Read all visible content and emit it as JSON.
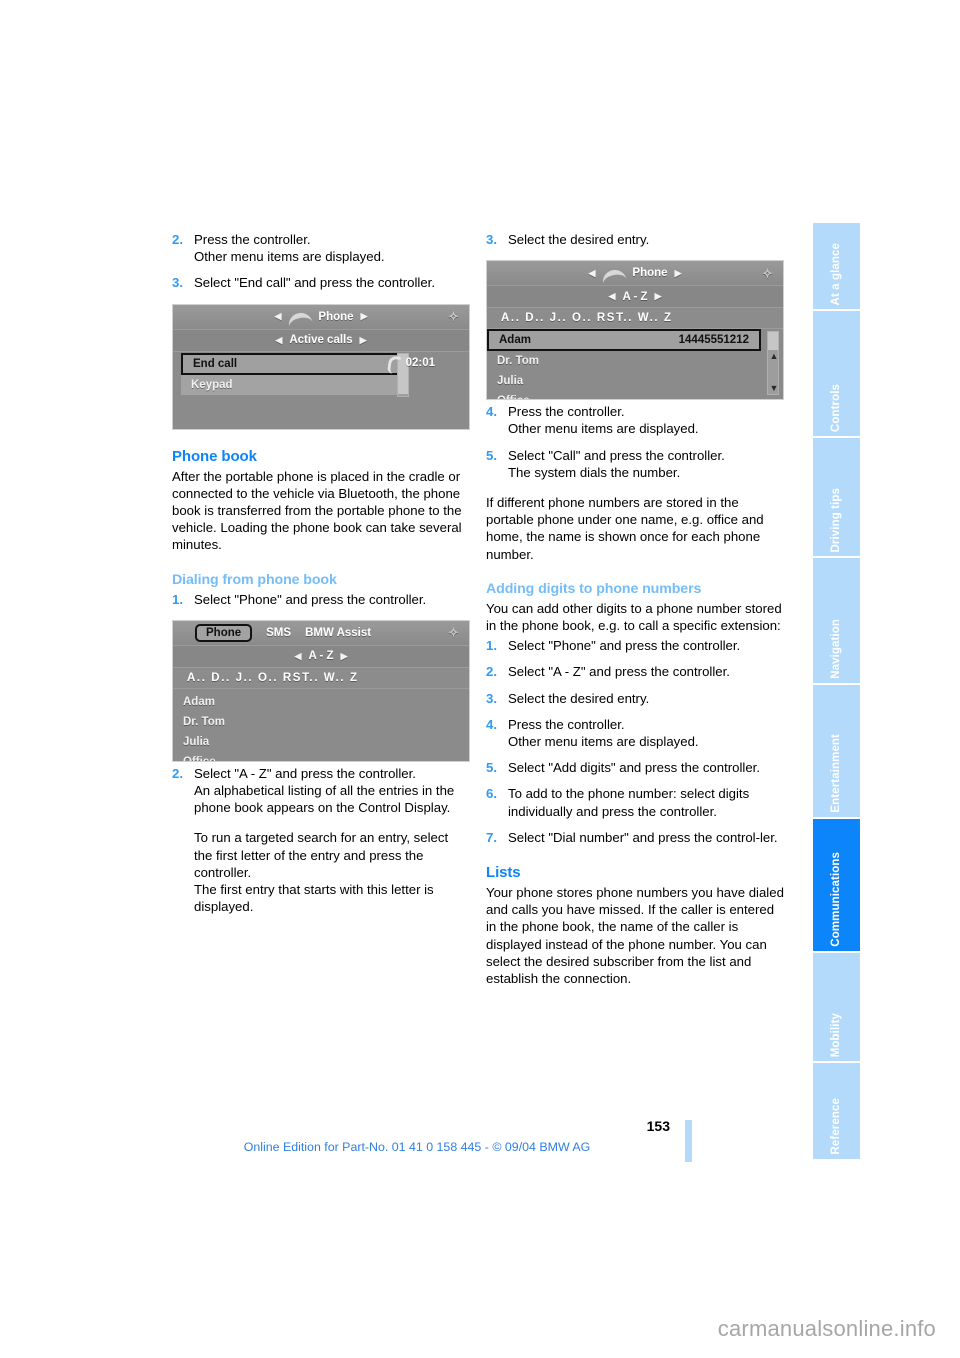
{
  "document": {
    "page_number": "153",
    "footer_text": "Online Edition for Part-No. 01 41 0 158 445 - © 09/04 BMW AG",
    "watermark": "carmanualsonline.info"
  },
  "sidebar": {
    "tabs": [
      {
        "label": "At a glance",
        "active": false
      },
      {
        "label": "Controls",
        "active": false
      },
      {
        "label": "Driving tips",
        "active": false
      },
      {
        "label": "Navigation",
        "active": false
      },
      {
        "label": "Entertainment",
        "active": false
      },
      {
        "label": "Communications",
        "active": true
      },
      {
        "label": "Mobility",
        "active": false
      },
      {
        "label": "Reference",
        "active": false
      }
    ]
  },
  "left_column": {
    "steps_top": [
      {
        "num": "2.",
        "lines": [
          "Press the controller.",
          "Other menu items are displayed."
        ]
      },
      {
        "num": "3.",
        "lines": [
          "Select \"End call\" and press the controller."
        ]
      }
    ],
    "screenshot_active_calls": {
      "header_title": "Phone",
      "subheader": "Active calls",
      "items": [
        {
          "label": "End call",
          "selected": true
        },
        {
          "label": "Keypad",
          "selected": false
        }
      ],
      "timer": "02:01"
    },
    "heading_phone_book": "Phone book",
    "phone_book_body": "After the portable phone is placed in the cradle or connected to the vehicle via Bluetooth, the phone book is transferred from the portable phone to the vehicle. Loading the phone book can take several minutes.",
    "heading_dialing": "Dialing from phone book",
    "steps_dialing_1": [
      {
        "num": "1.",
        "lines": [
          "Select \"Phone\" and press the controller."
        ]
      }
    ],
    "screenshot_phone_book": {
      "tabs": [
        "Phone",
        "SMS",
        "BMW Assist"
      ],
      "active_tab": "Phone",
      "subheader": "A - Z",
      "letters": "A..  D..  J..  O..  RST..  W.. Z",
      "entries": [
        "Adam",
        "Dr. Tom",
        "Julia",
        "Office"
      ]
    },
    "steps_dialing_2": [
      {
        "num": "2.",
        "lines": [
          "Select \"A - Z\" and press the controller.",
          "An alphabetical listing of all the entries in the phone book appears on the Control Display."
        ],
        "extra_paragraphs": [
          "To run a targeted search for an entry, select the first letter of the entry and press the controller.",
          "The first entry that starts with this letter is displayed."
        ]
      }
    ]
  },
  "right_column": {
    "steps_top": [
      {
        "num": "3.",
        "lines": [
          "Select the desired entry."
        ]
      }
    ],
    "screenshot_entry_selected": {
      "header_title": "Phone",
      "subheader": "A - Z",
      "letters": "A..  D..  J..  O..  RST..  W.. Z",
      "selected_entry": {
        "name": "Adam",
        "number": "14445551212"
      },
      "entries": [
        "Dr. Tom",
        "Julia",
        "Office"
      ]
    },
    "steps_after": [
      {
        "num": "4.",
        "lines": [
          "Press the controller.",
          "Other menu items are displayed."
        ]
      },
      {
        "num": "5.",
        "lines": [
          "Select \"Call\" and press the controller.",
          "The system dials the number."
        ]
      }
    ],
    "note_paragraph": "If different phone numbers are stored in the portable phone under one name, e.g. office and home, the name is shown once for each phone number.",
    "heading_adding_digits": "Adding digits to phone numbers",
    "adding_digits_intro": "You can add other digits to a phone number stored in the phone book, e.g. to call a specific extension:",
    "steps_adding": [
      {
        "num": "1.",
        "lines": [
          "Select \"Phone\" and press the controller."
        ]
      },
      {
        "num": "2.",
        "lines": [
          "Select \"A - Z\" and press the controller."
        ]
      },
      {
        "num": "3.",
        "lines": [
          "Select the desired entry."
        ]
      },
      {
        "num": "4.",
        "lines": [
          "Press the controller.",
          "Other menu items are displayed."
        ]
      },
      {
        "num": "5.",
        "lines": [
          "Select \"Add digits\" and press the controller."
        ]
      },
      {
        "num": "6.",
        "lines": [
          "To add to the phone number: select digits individually and press the controller."
        ]
      },
      {
        "num": "7.",
        "lines": [
          "Select \"Dial number\" and press the control-ler."
        ]
      }
    ],
    "heading_lists": "Lists",
    "lists_body": "Your phone stores phone numbers you have dialed and calls you have missed. If the caller is entered in the phone book, the name of the caller is displayed instead of the phone number. You can select the desired subscriber from the list and establish the connection."
  },
  "colors": {
    "accent_blue": "#0c84fa",
    "light_blue": "#74bdf7",
    "tab_inactive": "#b3d9fb",
    "step_number": "#2f9bf5"
  }
}
